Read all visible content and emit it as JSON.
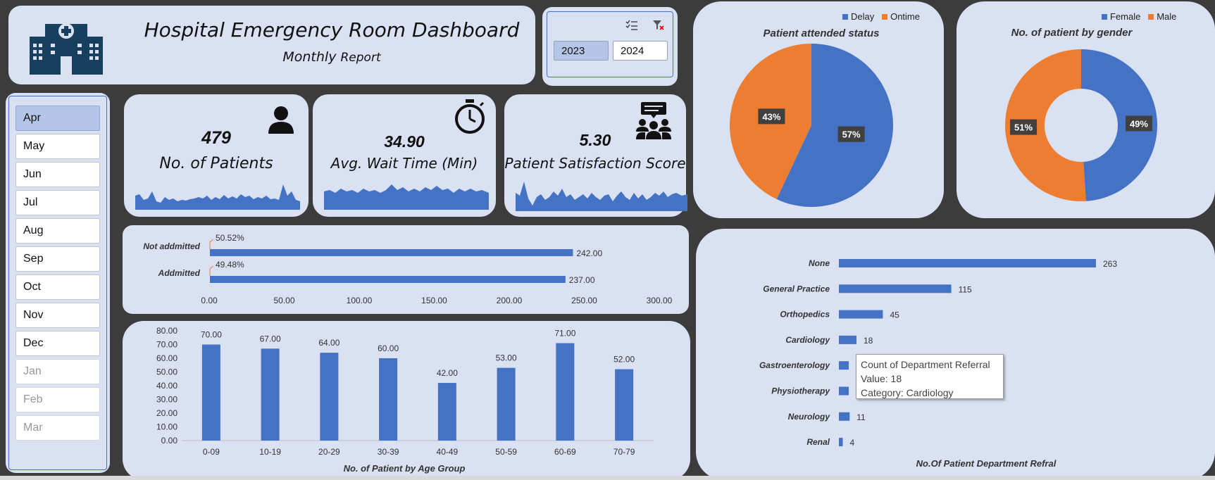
{
  "header": {
    "title": "Hospital Emergency Room Dashboard",
    "subtitle_main": "Monthly",
    "subtitle_rest": "Report"
  },
  "year_slicer": {
    "years": [
      "2023",
      "2024"
    ],
    "selected": "2023"
  },
  "month_slicer": {
    "months": [
      {
        "label": "Apr",
        "state": "selected"
      },
      {
        "label": "May",
        "state": "normal"
      },
      {
        "label": "Jun",
        "state": "normal"
      },
      {
        "label": "Jul",
        "state": "normal"
      },
      {
        "label": "Aug",
        "state": "normal"
      },
      {
        "label": "Sep",
        "state": "normal"
      },
      {
        "label": "Oct",
        "state": "normal"
      },
      {
        "label": "Nov",
        "state": "normal"
      },
      {
        "label": "Dec",
        "state": "normal"
      },
      {
        "label": "Jan",
        "state": "dim"
      },
      {
        "label": "Feb",
        "state": "dim"
      },
      {
        "label": "Mar",
        "state": "dim"
      }
    ]
  },
  "kpis": {
    "patients": {
      "value": "479",
      "label": "No. of Patients",
      "icon": "person-icon"
    },
    "wait": {
      "value": "34.90",
      "label": "Avg. Wait Time (Min)",
      "icon": "stopwatch-icon"
    },
    "satisfaction": {
      "value": "5.30",
      "label": "Patient Satisfaction Score",
      "icon": "group-feedback-icon"
    }
  },
  "colors": {
    "blue": "#4472c4",
    "orange": "#ed7d31",
    "card": "#d9e1f2",
    "background": "#3c3c3c"
  },
  "chart_data": [
    {
      "id": "attended_status",
      "type": "pie",
      "title": "Patient attended status",
      "legend": [
        "Delay",
        "Ontime"
      ],
      "series": [
        {
          "name": "Delay",
          "value": 57,
          "label": "57%"
        },
        {
          "name": "Ontime",
          "value": 43,
          "label": "43%"
        }
      ],
      "legend_position": "top-right"
    },
    {
      "id": "gender",
      "type": "pie",
      "title": "No. of patient by gender",
      "legend": [
        "Female",
        "Male"
      ],
      "series": [
        {
          "name": "Female",
          "value": 49,
          "label": "49%"
        },
        {
          "name": "Male",
          "value": 51,
          "label": "51%"
        }
      ],
      "legend_position": "top-right"
    },
    {
      "id": "admission",
      "type": "bar",
      "categories": [
        "Not addmitted",
        "Addmitted"
      ],
      "values": [
        242,
        237
      ],
      "value_labels": [
        "242.00",
        "237.00"
      ],
      "pct_labels": [
        "50.52%",
        "49.48%"
      ],
      "xlim": [
        0,
        300
      ],
      "xticks": [
        "0.00",
        "50.00",
        "100.00",
        "150.00",
        "200.00",
        "250.00",
        "300.00"
      ]
    },
    {
      "id": "age_group",
      "type": "bar",
      "title": "No. of Patient by Age Group",
      "categories": [
        "0-09",
        "10-19",
        "20-29",
        "30-39",
        "40-49",
        "50-59",
        "60-69",
        "70-79"
      ],
      "values": [
        70,
        67,
        64,
        60,
        42,
        53,
        71,
        52
      ],
      "value_labels": [
        "70.00",
        "67.00",
        "64.00",
        "60.00",
        "42.00",
        "53.00",
        "71.00",
        "52.00"
      ],
      "ylim": [
        0,
        80
      ],
      "yticks": [
        "0.00",
        "10.00",
        "20.00",
        "30.00",
        "40.00",
        "50.00",
        "60.00",
        "70.00",
        "80.00"
      ]
    },
    {
      "id": "department",
      "type": "bar",
      "title": "No.Of Patient Department Refral",
      "categories": [
        "None",
        "General Practice",
        "Orthopedics",
        "Cardiology",
        "Gastroenterology",
        "Physiotherapy",
        "Neurology",
        "Renal"
      ],
      "values": [
        263,
        115,
        45,
        18,
        0,
        0,
        11,
        4
      ],
      "value_labels": [
        "263",
        "115",
        "45",
        "18",
        "",
        "",
        "11",
        "4"
      ]
    }
  ],
  "tooltip": {
    "line1": "Count of Department Referral",
    "line2": "Value: 18",
    "line3": "Category: Cardiology"
  }
}
